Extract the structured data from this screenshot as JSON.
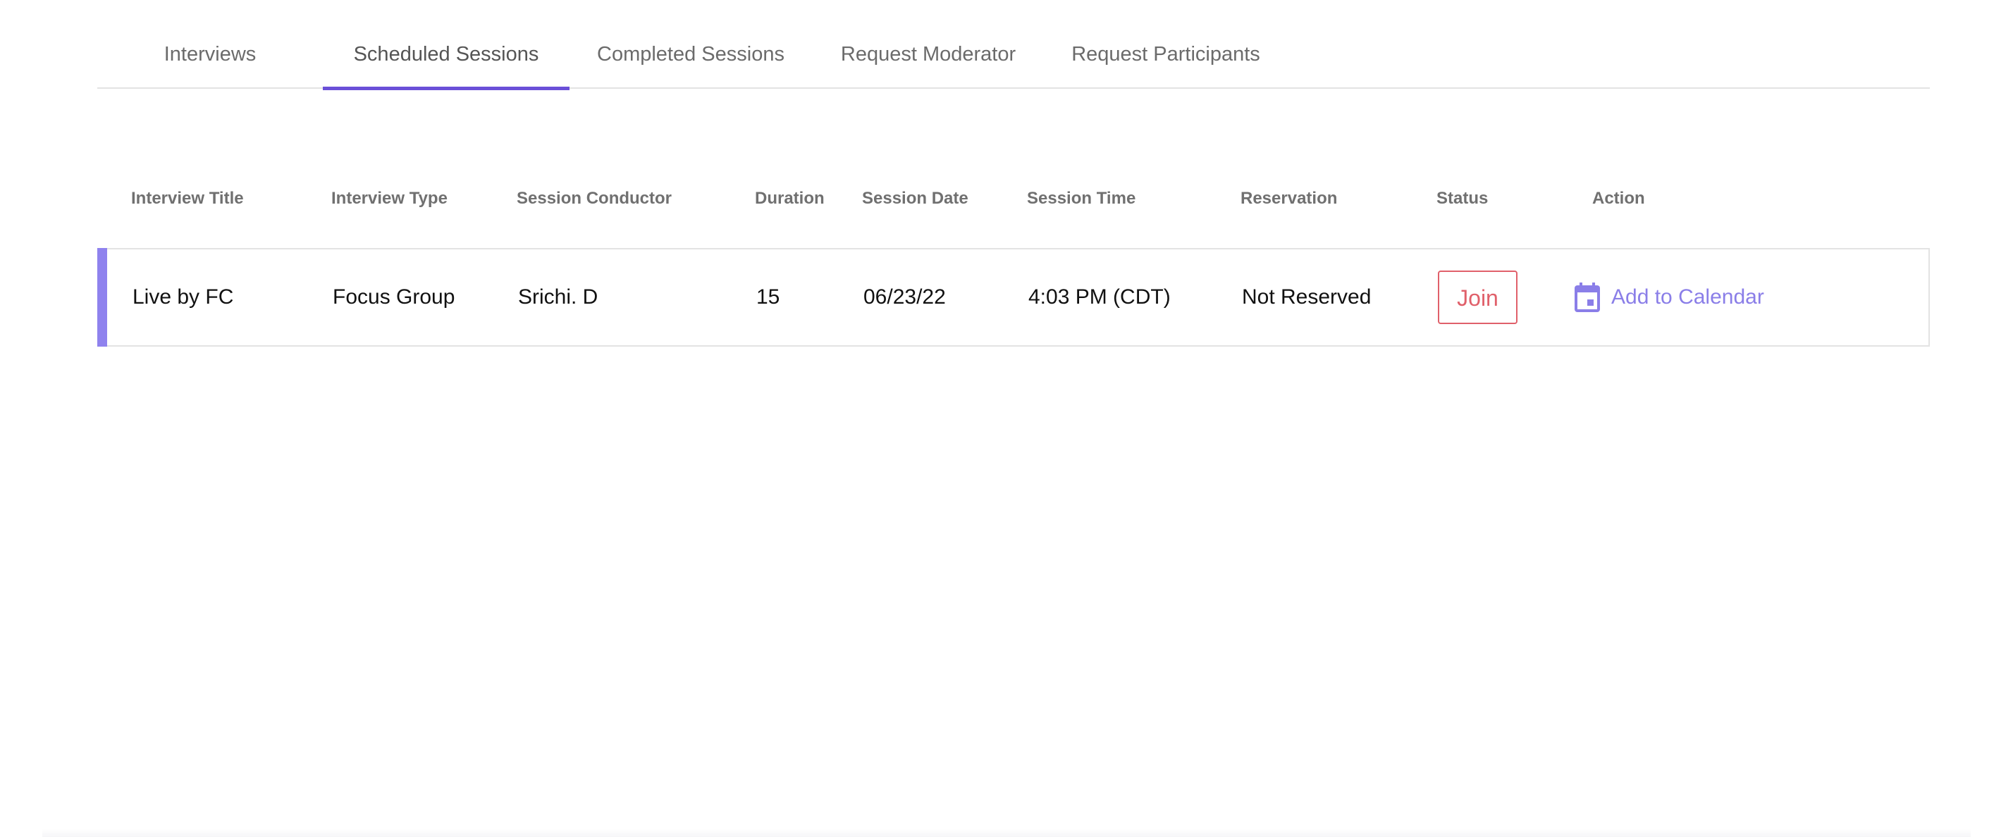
{
  "tabs": [
    {
      "label": "Interviews",
      "active": false
    },
    {
      "label": "Scheduled Sessions",
      "active": true
    },
    {
      "label": "Completed Sessions",
      "active": false
    },
    {
      "label": "Request Moderator",
      "active": false
    },
    {
      "label": "Request Participants",
      "active": false
    }
  ],
  "table": {
    "headers": {
      "interview_title": "Interview Title",
      "interview_type": "Interview Type",
      "session_conductor": "Session Conductor",
      "duration": "Duration",
      "session_date": "Session Date",
      "session_time": "Session Time",
      "reservation": "Reservation",
      "status": "Status",
      "action": "Action"
    },
    "rows": [
      {
        "interview_title": "Live by FC",
        "interview_type": "Focus Group",
        "session_conductor": "Srichi. D",
        "duration": "15",
        "session_date": "06/23/22",
        "session_time": "4:03 PM (CDT)",
        "reservation": "Not Reserved",
        "status_button": "Join",
        "action_label": "Add to Calendar",
        "action_icon": "calendar-icon"
      }
    ]
  },
  "colors": {
    "accent": "#6a4fd8",
    "row_marker": "#8f82ee",
    "join": "#e0606a",
    "link": "#8a7ee8"
  }
}
